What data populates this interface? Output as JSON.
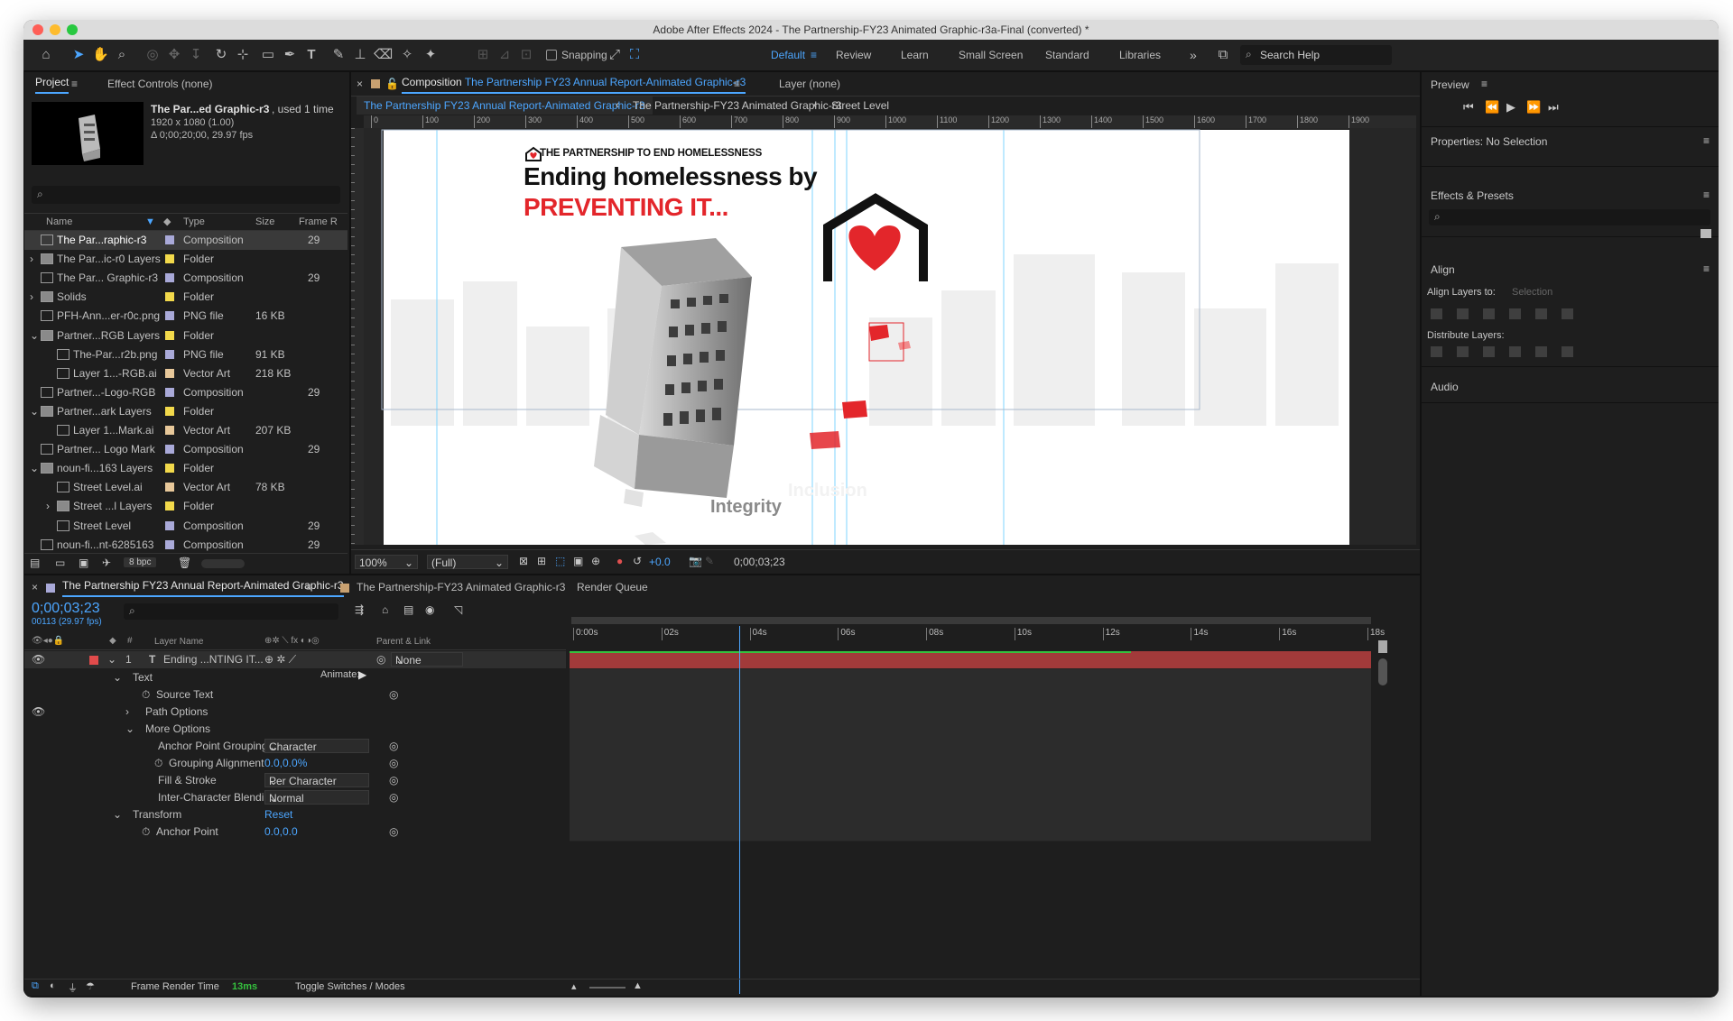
{
  "window": {
    "title": "Adobe After Effects 2024 - The Partnership-FY23 Animated Graphic-r3a-Final (converted) *"
  },
  "toolbar": {
    "snapping_label": "Snapping",
    "workspaces": [
      "Default",
      "Review",
      "Learn",
      "Small Screen",
      "Standard",
      "Libraries"
    ],
    "search_placeholder": "Search Help"
  },
  "project_panel": {
    "tabs": {
      "project": "Project",
      "effect_controls": "Effect Controls (none)"
    },
    "selected": {
      "name": "The Par...ed Graphic-r3",
      "used": ", used 1 time",
      "dims": "1920 x 1080 (1.00)",
      "duration": "Δ 0;00;20;00, 29.97 fps"
    },
    "columns": {
      "name": "Name",
      "type": "Type",
      "size": "Size",
      "frame": "Frame R"
    },
    "items": [
      {
        "name": "The Par...raphic-r3",
        "color": "#a9a9d8",
        "type": "Composition",
        "size": "",
        "frame": "29"
      },
      {
        "name": "The Par...ic-r0 Layers",
        "color": "#f2d94b",
        "type": "Folder",
        "size": "",
        "frame": ""
      },
      {
        "name": "The Par... Graphic-r3",
        "color": "#a9a9d8",
        "type": "Composition",
        "size": "",
        "frame": "29"
      },
      {
        "name": "Solids",
        "color": "#f2d94b",
        "type": "Folder",
        "size": "",
        "frame": ""
      },
      {
        "name": "PFH-Ann...er-r0c.png",
        "color": "#a9a9d8",
        "type": "PNG file",
        "size": "16 KB",
        "frame": ""
      },
      {
        "name": "Partner...RGB Layers",
        "color": "#f2d94b",
        "type": "Folder",
        "size": "",
        "frame": ""
      },
      {
        "name": "The-Par...r2b.png",
        "color": "#a9a9d8",
        "type": "PNG file",
        "size": "91 KB",
        "frame": ""
      },
      {
        "name": "Layer 1...-RGB.ai",
        "color": "#e8c89a",
        "type": "Vector Art",
        "size": "218 KB",
        "frame": ""
      },
      {
        "name": "Partner...-Logo-RGB",
        "color": "#a9a9d8",
        "type": "Composition",
        "size": "",
        "frame": "29"
      },
      {
        "name": "Partner...ark Layers",
        "color": "#f2d94b",
        "type": "Folder",
        "size": "",
        "frame": ""
      },
      {
        "name": "Layer 1...Mark.ai",
        "color": "#e8c89a",
        "type": "Vector Art",
        "size": "207 KB",
        "frame": ""
      },
      {
        "name": "Partner... Logo Mark",
        "color": "#a9a9d8",
        "type": "Composition",
        "size": "",
        "frame": "29"
      },
      {
        "name": "noun-fi...163 Layers",
        "color": "#f2d94b",
        "type": "Folder",
        "size": "",
        "frame": ""
      },
      {
        "name": "Street Level.ai",
        "color": "#e8c89a",
        "type": "Vector Art",
        "size": "78 KB",
        "frame": ""
      },
      {
        "name": "Street ...l Layers",
        "color": "#f2d94b",
        "type": "Folder",
        "size": "",
        "frame": ""
      },
      {
        "name": "Street Level",
        "color": "#a9a9d8",
        "type": "Composition",
        "size": "",
        "frame": "29"
      },
      {
        "name": "noun-fi...nt-6285163",
        "color": "#a9a9d8",
        "type": "Composition",
        "size": "",
        "frame": "29"
      }
    ],
    "bpc": "8 bpc"
  },
  "comp_panel": {
    "tab_prefix": "Composition",
    "tab_name": "The Partnership  FY23 Annual Report-Animated Graphic-r3",
    "layer_tab": "Layer (none)",
    "breadcrumbs": [
      "The Partnership  FY23 Annual Report-Animated Graphic-r3",
      "The Partnership-FY23 Animated Graphic-r3",
      "Street Level"
    ],
    "ruler": [
      "0",
      "100",
      "200",
      "300",
      "400",
      "500",
      "600",
      "700",
      "800",
      "900",
      "1000",
      "1100",
      "1200",
      "1300",
      "1400",
      "1500",
      "1600",
      "1700",
      "1800",
      "1900"
    ],
    "zoom": "100%",
    "resolution": "(Full)",
    "exposure": "+0.0",
    "timecode": "0;00;03;23"
  },
  "artwork": {
    "org": "THE PARTNERSHIP TO END HOMELESSNESS",
    "headline1": "Ending homelessness by",
    "headline2": "PREVENTING IT...",
    "word1": "Integrity",
    "word2": "Inclusion",
    "red": "#e3262b"
  },
  "timeline": {
    "tabs": [
      "The Partnership  FY23 Annual Report-Animated Graphic-r3",
      "The Partnership-FY23 Animated Graphic-r3",
      "Render Queue"
    ],
    "timecode": "0;00;03;23",
    "frame_info": "00113 (29.97 fps)",
    "col_layer_name": "Layer Name",
    "col_parent": "Parent & Link",
    "layer": {
      "num": "1",
      "name": "Ending ...NTING IT...",
      "parent": "None"
    },
    "animate_label": "Animate:",
    "props": [
      {
        "label": "Text",
        "indent": 0,
        "twirl": "v"
      },
      {
        "label": "Source Text",
        "indent": 1,
        "stopwatch": true
      },
      {
        "label": "Path Options",
        "indent": 1,
        "twirl": ">"
      },
      {
        "label": "More Options",
        "indent": 1,
        "twirl": "v"
      },
      {
        "label": "Anchor Point Grouping",
        "indent": 2,
        "dropdown": "Character"
      },
      {
        "label": "Grouping Alignment",
        "indent": 2,
        "stopwatch": true,
        "value": "0.0,0.0%"
      },
      {
        "label": "Fill & Stroke",
        "indent": 2,
        "dropdown": "Per Character Palette"
      },
      {
        "label": "Inter-Character Blending",
        "indent": 2,
        "dropdown": "Normal"
      },
      {
        "label": "Transform",
        "indent": 0,
        "twirl": "v",
        "value": "Reset"
      },
      {
        "label": "Anchor Point",
        "indent": 1,
        "stopwatch": true,
        "value": "0.0,0.0"
      }
    ],
    "ruler": [
      "0:00s",
      "02s",
      "04s",
      "06s",
      "08s",
      "10s",
      "12s",
      "14s",
      "16s",
      "18s"
    ],
    "playhead_seconds": 3.77,
    "duration_seconds": 18,
    "footer": {
      "render_label": "Frame Render Time",
      "render_value": "13ms",
      "toggle": "Toggle Switches / Modes"
    }
  },
  "right_panel": {
    "preview": "Preview",
    "properties": "Properties: No Selection",
    "effects": "Effects & Presets",
    "align": "Align",
    "align_to_label": "Align Layers to:",
    "align_to_value": "Selection",
    "distribute": "Distribute Layers:",
    "audio": "Audio"
  }
}
